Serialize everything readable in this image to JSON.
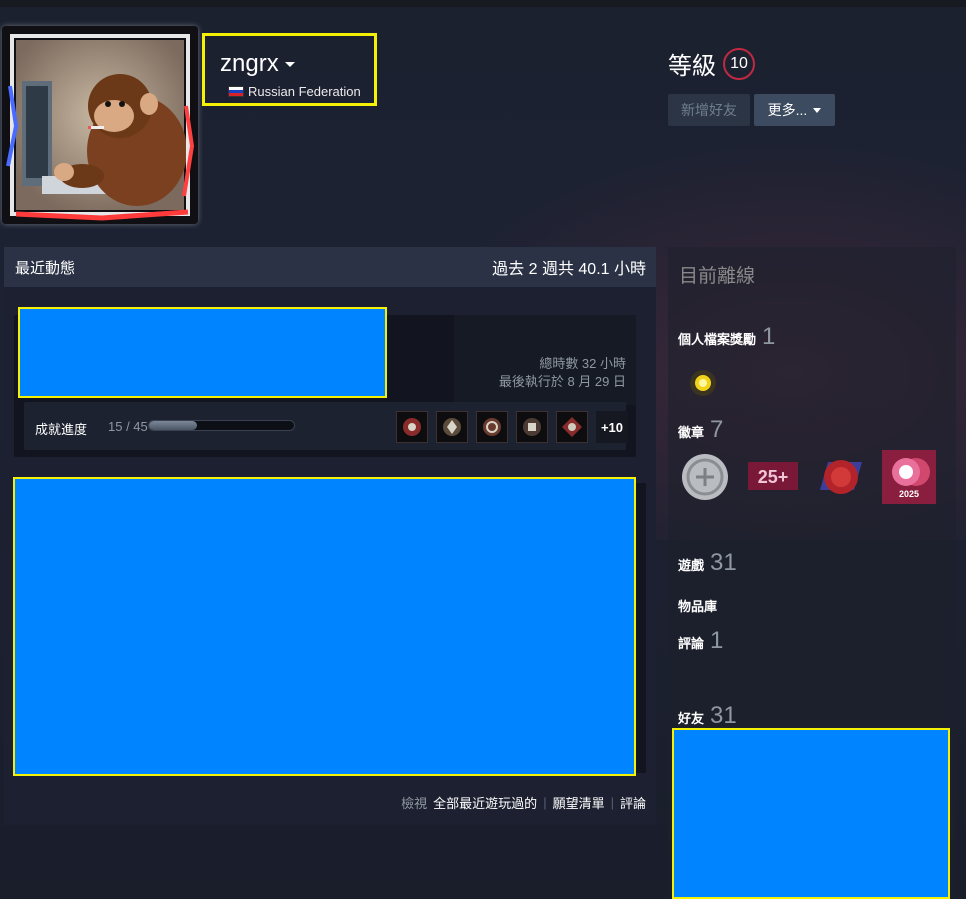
{
  "profile": {
    "persona_name": "zngrx",
    "country": "Russian Federation",
    "level_label": "等級",
    "level": "10",
    "add_friend_label": "新增好友",
    "more_label": "更多..."
  },
  "recent_activity": {
    "title": "最近動態",
    "hours_summary": "過去 2 週共 40.1 小時",
    "game": {
      "total_hours": "總時數 32 小時",
      "last_played": "最後執行於 8 月 29 日",
      "achievement_label": "成就進度",
      "achievement_count": "15 / 45",
      "achievement_progress": 0.333,
      "more_achievements": "+10"
    },
    "footer": {
      "view_label": "檢視",
      "link_all_recent": "全部最近遊玩過的",
      "link_wishlist": "願望清單",
      "link_reviews": "評論"
    }
  },
  "sidebar": {
    "status": "目前離線",
    "awards_label": "個人檔案獎勵",
    "awards_count": "1",
    "badges_label": "徽章",
    "badges_count": "7",
    "badge_2_text": "25+",
    "badge_4_text": "2025",
    "games_label": "遊戲",
    "games_count": "31",
    "inventory_label": "物品庫",
    "reviews_label": "評論",
    "reviews_count": "1",
    "friends_label": "好友",
    "friends_count": "31"
  },
  "colors": {
    "redaction": "#0084ff",
    "highlight_border": "#f5f106",
    "level_ring": "#c02942"
  }
}
